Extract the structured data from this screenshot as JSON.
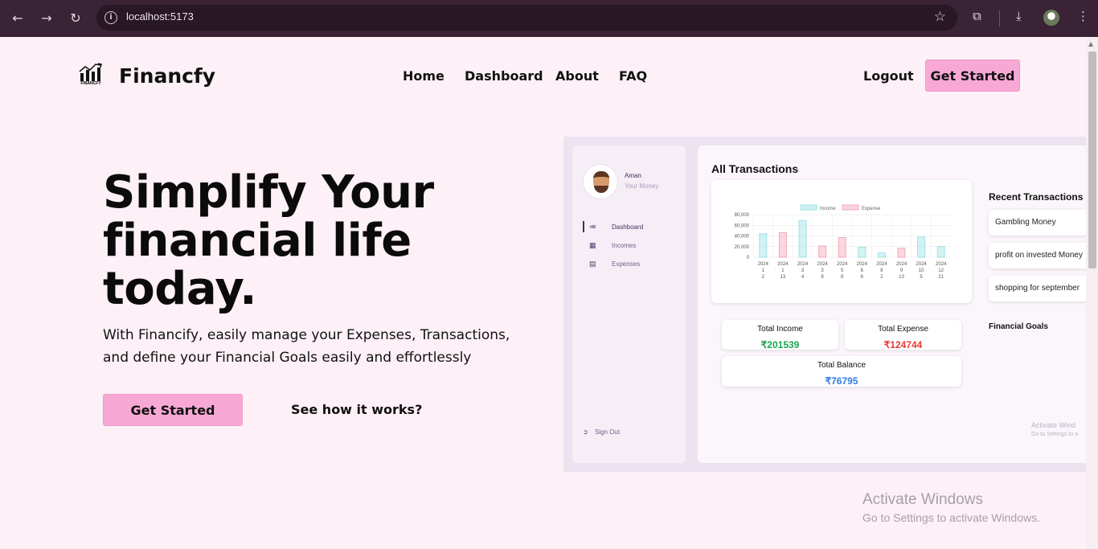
{
  "browser": {
    "url": "localhost:5173"
  },
  "header": {
    "brand": "Financfy",
    "logo_caption": "FINANCFY",
    "nav": [
      "Home",
      "Dashboard",
      "About",
      "FAQ"
    ],
    "logout": "Logout",
    "cta": "Get Started"
  },
  "hero": {
    "title": "Simplify Your financial life today.",
    "subtitle": "With Financify, easily manage your Expenses, Transactions, and define your Financial Goals easily and effortlessly",
    "cta_primary": "Get Started",
    "cta_secondary": "See how it works?"
  },
  "preview": {
    "user_name": "Aman",
    "user_tagline": "Your Money",
    "menu": [
      "Dashboard",
      "Incomes",
      "Expenses"
    ],
    "sign_out": "Sign Out",
    "title": "All Transactions",
    "total_income_label": "Total Income",
    "total_income": "₹201539",
    "total_expense_label": "Total Expense",
    "total_expense": "₹124744",
    "total_balance_label": "Total Balance",
    "total_balance": "₹76795",
    "recent_title": "Recent Transactions",
    "recent": [
      "Gambling Money",
      "profit on invested Money",
      "shopping for september"
    ],
    "goals_title": "Financial Goals",
    "watermark_big": "Activate Wind",
    "watermark_small": "Go to Settings to a"
  },
  "chart_data": {
    "type": "bar",
    "legend": [
      "Income",
      "Expense"
    ],
    "ylim": [
      0,
      80000
    ],
    "yticks": [
      "0",
      "20,000",
      "40,000",
      "60,000",
      "80,000"
    ],
    "categories": [
      [
        "2024",
        "1",
        "2"
      ],
      [
        "2024",
        "1",
        "13"
      ],
      [
        "2024",
        "3",
        "4"
      ],
      [
        "2024",
        "3",
        "8"
      ],
      [
        "2024",
        "5",
        "8"
      ],
      [
        "2024",
        "6",
        "6"
      ],
      [
        "2024",
        "8",
        "2"
      ],
      [
        "2024",
        "9",
        "13"
      ],
      [
        "2024",
        "10",
        "5"
      ],
      [
        "2024",
        "12",
        "21"
      ]
    ],
    "series": [
      {
        "name": "Income",
        "color": "#9ee3e6",
        "values": [
          44000,
          0,
          69000,
          0,
          0,
          19000,
          8000,
          0,
          38000,
          20000
        ]
      },
      {
        "name": "Expense",
        "color": "#f4a9bb",
        "values": [
          0,
          46000,
          0,
          21000,
          37000,
          0,
          0,
          17000,
          0,
          0
        ]
      }
    ]
  },
  "system": {
    "activate_title": "Activate Windows",
    "activate_sub": "Go to Settings to activate Windows."
  },
  "colors": {
    "accent": "#f7a8d4",
    "income": "#1aa552",
    "expense": "#e53935",
    "balance": "#2f7de1"
  }
}
